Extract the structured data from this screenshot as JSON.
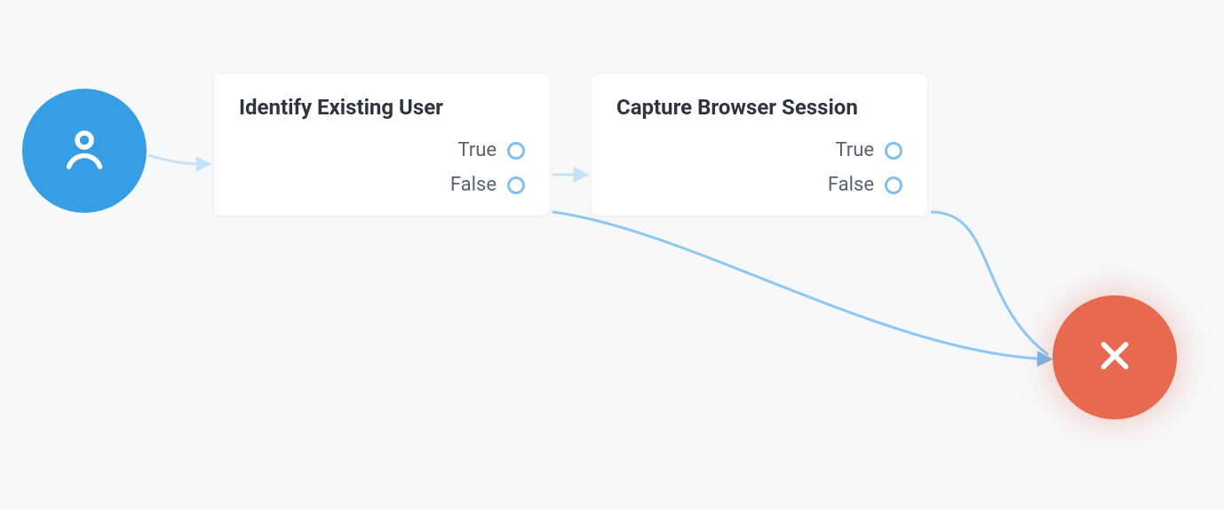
{
  "nodes": {
    "start": {
      "icon": "user-icon",
      "color": "#359ee5"
    },
    "identify": {
      "title": "Identify Existing User",
      "outputs": {
        "true": "True",
        "false": "False"
      }
    },
    "capture": {
      "title": "Capture Browser Session",
      "outputs": {
        "true": "True",
        "false": "False"
      }
    },
    "end": {
      "icon": "close-icon",
      "color": "#e7694f"
    }
  },
  "connectors": {
    "strokeLight": "#c7e1f7",
    "strokeMedium": "#8ec7f1"
  }
}
